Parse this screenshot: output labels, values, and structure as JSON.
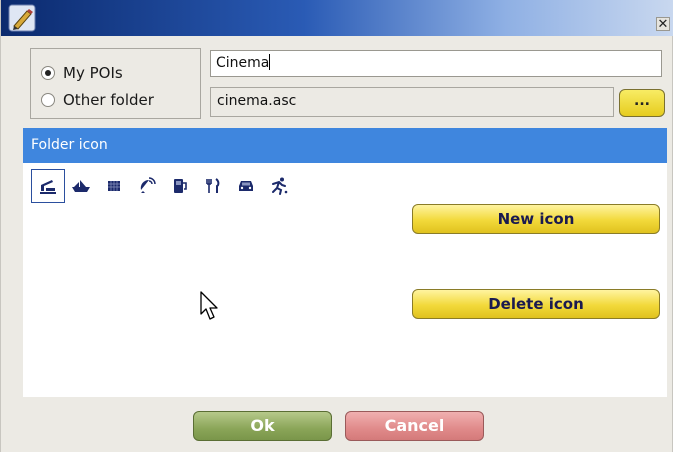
{
  "window": {
    "app_icon": "pen-icon",
    "close_label": "✕"
  },
  "source": {
    "options": [
      {
        "label": "My POIs",
        "checked": true
      },
      {
        "label": "Other folder",
        "checked": false
      }
    ]
  },
  "name_input": {
    "value": "Cinema"
  },
  "file": {
    "value": "cinema.asc",
    "browse_label": "..."
  },
  "folder_icon": {
    "header": "Folder icon",
    "icons": [
      "cinema-icon",
      "boat-icon",
      "grid-icon",
      "satellite-icon",
      "fuel-icon",
      "restaurant-icon",
      "car-icon",
      "runner-icon"
    ],
    "selected_index": 0,
    "new_icon_label": "New icon",
    "delete_icon_label": "Delete icon"
  },
  "actions": {
    "ok_label": "Ok",
    "cancel_label": "Cancel"
  },
  "colors": {
    "title_gradient_start": "#0b2a6e",
    "header_blue": "#3f86de",
    "button_yellow": "#f2d93a",
    "ok_green": "#8aa558",
    "cancel_red": "#e08a8a",
    "icon_navy": "#1c2a6b"
  }
}
